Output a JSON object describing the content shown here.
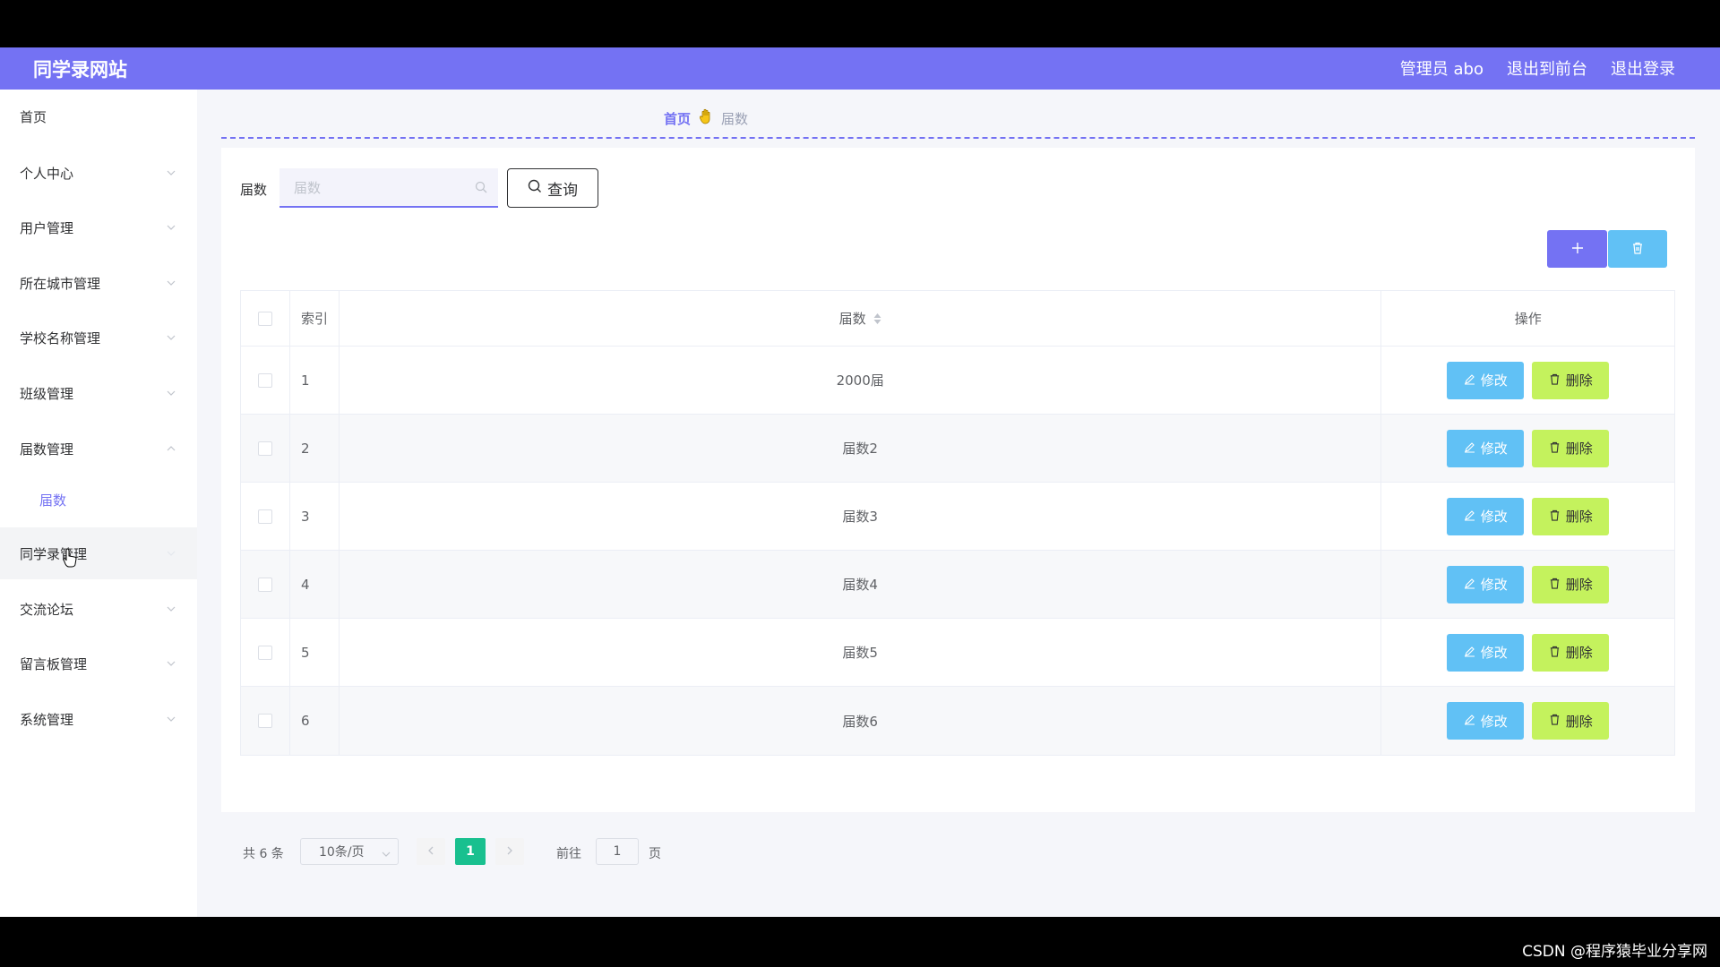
{
  "header": {
    "site_title": "同学录网站",
    "admin_label": "管理员 abo",
    "exit_front": "退出到前台",
    "logout": "退出登录"
  },
  "sidebar": {
    "items": [
      {
        "label": "首页"
      },
      {
        "label": "个人中心"
      },
      {
        "label": "用户管理"
      },
      {
        "label": "所在城市管理"
      },
      {
        "label": "学校名称管理"
      },
      {
        "label": "班级管理"
      },
      {
        "label": "届数管理"
      },
      {
        "label": "届数"
      },
      {
        "label": "同学录管理"
      },
      {
        "label": "交流论坛"
      },
      {
        "label": "留言板管理"
      },
      {
        "label": "系统管理"
      }
    ]
  },
  "breadcrumb": {
    "home": "首页",
    "current": "届数"
  },
  "search": {
    "label": "届数",
    "placeholder": "届数",
    "query_button": "查询"
  },
  "table": {
    "headers": {
      "index": "索引",
      "jieshu": "届数",
      "operation": "操作"
    },
    "rows": [
      {
        "index": "1",
        "jieshu": "2000届"
      },
      {
        "index": "2",
        "jieshu": "届数2"
      },
      {
        "index": "3",
        "jieshu": "届数3"
      },
      {
        "index": "4",
        "jieshu": "届数4"
      },
      {
        "index": "5",
        "jieshu": "届数5"
      },
      {
        "index": "6",
        "jieshu": "届数6"
      }
    ],
    "edit_label": "修改",
    "delete_label": "删除"
  },
  "pagination": {
    "total": "共 6 条",
    "page_size": "10条/页",
    "current_page": "1",
    "goto_label": "前往",
    "goto_value": "1",
    "page_unit": "页"
  },
  "watermark": "CSDN @程序猿毕业分享网",
  "colors": {
    "primary": "#7472f3",
    "edit": "#61c1f5",
    "delete": "#c4f25d",
    "pager_active": "#19c08f"
  }
}
